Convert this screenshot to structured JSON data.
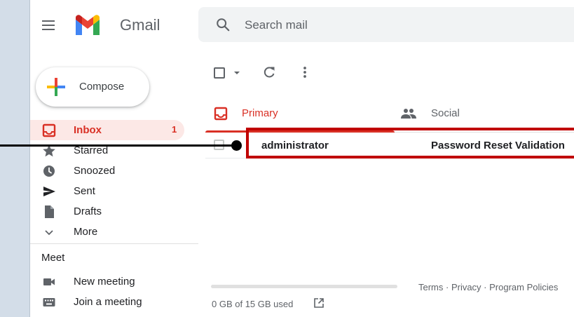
{
  "header": {
    "brand": "Gmail",
    "search_placeholder": "Search mail"
  },
  "compose": {
    "label": "Compose"
  },
  "sidebar": {
    "items": [
      {
        "label": "Inbox",
        "count": "1",
        "icon": "inbox-icon"
      },
      {
        "label": "Starred",
        "icon": "star-icon"
      },
      {
        "label": "Snoozed",
        "icon": "clock-icon"
      },
      {
        "label": "Sent",
        "icon": "send-icon"
      },
      {
        "label": "Drafts",
        "icon": "draft-icon"
      },
      {
        "label": "More",
        "icon": "chevron-down-icon"
      }
    ],
    "meet": {
      "title": "Meet",
      "items": [
        {
          "label": "New meeting",
          "icon": "videocam-icon"
        },
        {
          "label": "Join a meeting",
          "icon": "keyboard-icon"
        }
      ]
    }
  },
  "tabs": [
    {
      "label": "Primary",
      "active": true
    },
    {
      "label": "Social",
      "active": false
    }
  ],
  "emails": [
    {
      "sender": "administrator",
      "subject": "Password Reset Validation"
    }
  ],
  "footer": {
    "storage": "0 GB of 15 GB used",
    "storage_fraction": 0.0,
    "links": "Terms · Privacy · Program Policies"
  },
  "colors": {
    "accent_red": "#d93025",
    "highlight_box": "#c00000",
    "active_nav_bg": "#fce8e6"
  }
}
